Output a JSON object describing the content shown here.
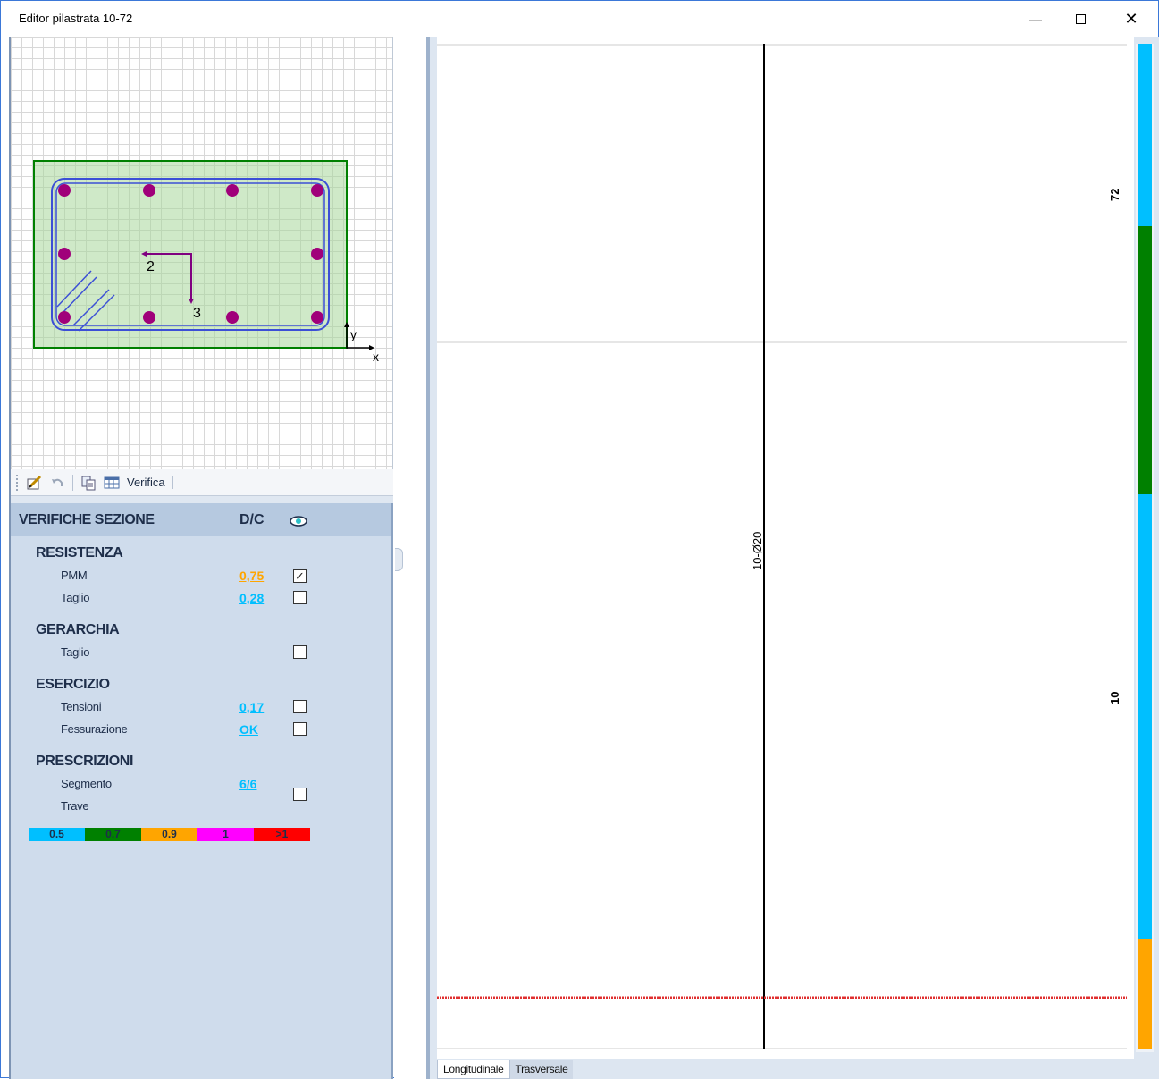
{
  "window": {
    "title": "Editor pilastrata 10-72"
  },
  "toolbar": {
    "verify_label": "Verifica"
  },
  "section_drawing": {
    "label_axis2": "2",
    "label_axis3": "3",
    "label_x": "x",
    "label_y": "y"
  },
  "verifiche": {
    "header": "VERIFICHE SEZIONE",
    "dc_header": "D/C",
    "groups": {
      "resistenza": {
        "title": "RESISTENZA",
        "pmm_label": "PMM",
        "pmm_value": "0,75",
        "pmm_checked": true,
        "taglio_label": "Taglio",
        "taglio_value": "0,28",
        "taglio_checked": false
      },
      "gerarchia": {
        "title": "GERARCHIA",
        "taglio_label": "Taglio",
        "taglio_checked": false
      },
      "esercizio": {
        "title": "ESERCIZIO",
        "tensioni_label": "Tensioni",
        "tensioni_value": "0,17",
        "fessurazione_label": "Fessurazione",
        "fessurazione_value": "OK"
      },
      "prescrizioni": {
        "title": "PRESCRIZIONI",
        "segmento_label": "Segmento",
        "segmento_value": "6/6",
        "trave_label": "Trave"
      }
    },
    "legend": [
      {
        "label": "0.5",
        "color": "#00bfff"
      },
      {
        "label": "0.7",
        "color": "#008000"
      },
      {
        "label": "0.9",
        "color": "#ffa500"
      },
      {
        "label": "1",
        "color": "#ff00ff"
      },
      {
        "label": ">1",
        "color": "#ff0000"
      }
    ]
  },
  "column_view": {
    "rebar_label": "10-Ø20",
    "level_top": "72",
    "level_bottom": "10",
    "tabs": [
      "Longitudinale",
      "Trasversale"
    ]
  },
  "colors": {
    "orange": "#ffa500",
    "blue": "#00bfff",
    "green": "#008000"
  }
}
